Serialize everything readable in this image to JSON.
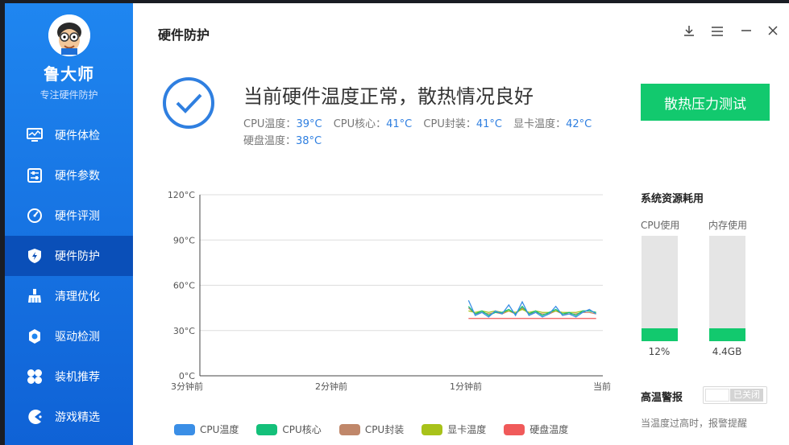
{
  "app": {
    "name": "鲁大师",
    "subtitle": "专注硬件防护"
  },
  "sidebar": {
    "items": [
      {
        "label": "硬件体检",
        "icon": "monitor-icon"
      },
      {
        "label": "硬件参数",
        "icon": "sliders-icon"
      },
      {
        "label": "硬件评测",
        "icon": "gauge-icon"
      },
      {
        "label": "硬件防护",
        "icon": "shield-icon",
        "active": true
      },
      {
        "label": "清理优化",
        "icon": "broom-icon"
      },
      {
        "label": "驱动检测",
        "icon": "gear-icon"
      },
      {
        "label": "装机推荐",
        "icon": "grid-icon"
      },
      {
        "label": "游戏精选",
        "icon": "gamepad-icon"
      }
    ]
  },
  "header": {
    "title": "硬件防护"
  },
  "status": {
    "title": "当前硬件温度正常，散热情况良好",
    "temps": [
      {
        "label": "CPU温度：",
        "value": "39°C"
      },
      {
        "label": "CPU核心：",
        "value": "41°C"
      },
      {
        "label": "CPU封装：",
        "value": "41°C"
      },
      {
        "label": "显卡温度：",
        "value": "42°C"
      },
      {
        "label": "硬盘温度：",
        "value": "38°C"
      }
    ]
  },
  "stress_button": "散热压力测试",
  "chart_data": {
    "type": "line",
    "y_ticks": [
      "120°C",
      "90°C",
      "60°C",
      "30°C",
      "0°C"
    ],
    "ylim": [
      0,
      120
    ],
    "x_ticks": [
      "3分钟前",
      "2分钟前",
      "1分钟前",
      "当前"
    ],
    "x": [
      0,
      3,
      6,
      9,
      12,
      15,
      18,
      21,
      24,
      27,
      30,
      33,
      36,
      39,
      42,
      45,
      48,
      51,
      54,
      57
    ],
    "series": [
      {
        "name": "CPU温度",
        "color": "#3a8ee6",
        "values": [
          50,
          40,
          42,
          39,
          43,
          41,
          47,
          40,
          49,
          40,
          42,
          39,
          41,
          46,
          40,
          41,
          39,
          42,
          44,
          41
        ]
      },
      {
        "name": "CPU核心",
        "color": "#14c07a",
        "values": [
          46,
          41,
          43,
          40,
          42,
          42,
          44,
          41,
          46,
          41,
          43,
          40,
          42,
          44,
          41,
          42,
          40,
          43,
          43,
          42
        ]
      },
      {
        "name": "CPU封装",
        "color": "#c0876a",
        "values": [
          45,
          41,
          42,
          41,
          42,
          41,
          43,
          41,
          45,
          41,
          42,
          41,
          41,
          43,
          41,
          41,
          41,
          42,
          42,
          41
        ]
      },
      {
        "name": "显卡温度",
        "color": "#a8c21a",
        "values": [
          43,
          42,
          43,
          42,
          43,
          42,
          43,
          42,
          44,
          42,
          43,
          42,
          42,
          43,
          42,
          42,
          42,
          43,
          43,
          42
        ]
      },
      {
        "name": "硬盘温度",
        "color": "#f05a5a",
        "values": [
          38,
          38,
          38,
          38,
          38,
          38,
          38,
          38,
          38,
          38,
          38,
          38,
          38,
          38,
          38,
          38,
          38,
          38,
          38,
          38
        ]
      }
    ],
    "grid": true
  },
  "resources": {
    "title": "系统资源耗用",
    "cpu": {
      "label": "CPU使用",
      "value": "12%",
      "fraction": 0.12
    },
    "mem": {
      "label": "内存使用",
      "value": "4.4GB",
      "fraction": 0.12
    }
  },
  "alarm": {
    "title": "高温警报",
    "toggle_text": "已关闭",
    "desc": "当温度过高时，报警提醒"
  }
}
